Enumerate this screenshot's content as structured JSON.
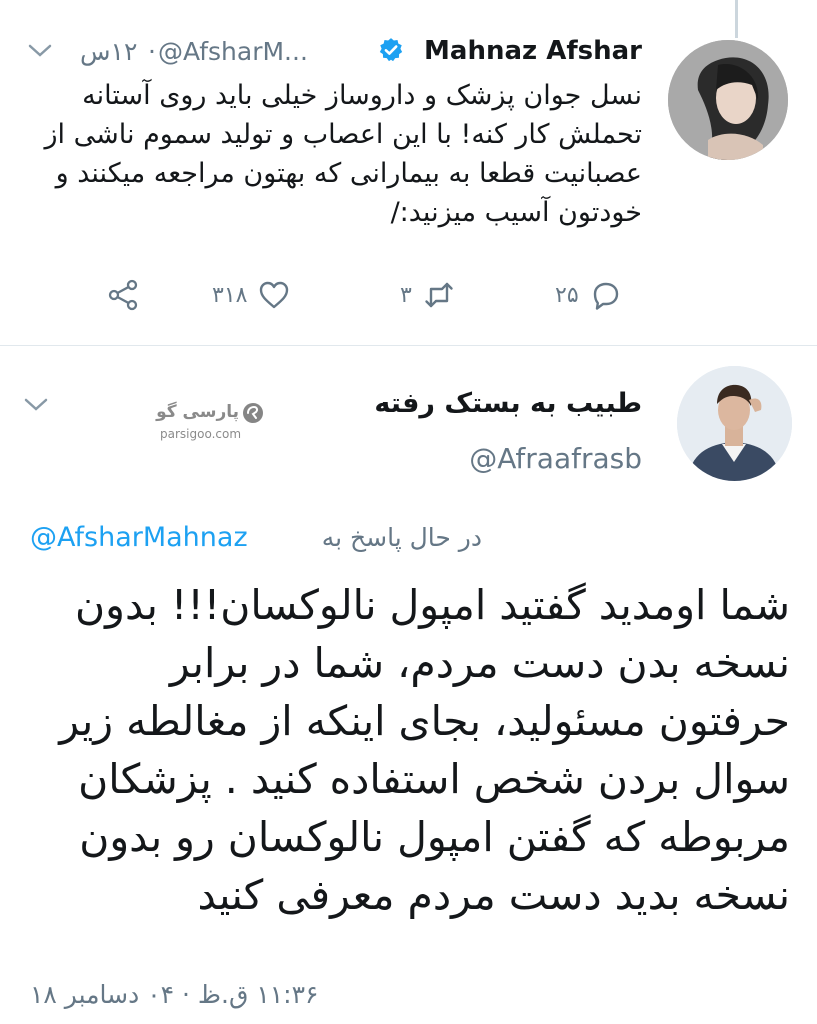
{
  "reply_tweet": {
    "author_name": "Mahnaz Afshar",
    "handle": "@AfsharM...",
    "separator": "·",
    "time": "۱۲س",
    "text": "نسل جوان پزشک و داروساز خیلی باید روی آستانه تحملش کار کنه! با این اعصاب و تولید سموم ناشی از عصبانیت قطعا به بیمارانی که بهتون مراجعه میکنند و خودتون آسیب میزنید:/",
    "actions": {
      "reply_count": "۲۵",
      "retweet_count": "۳",
      "like_count": "۳۱۸"
    }
  },
  "main_tweet": {
    "author_name": "طبیب به بستک رفته",
    "handle": "@Afraafrasb",
    "replying_label": "در حال پاسخ به",
    "replying_handle": "@AfsharMahnaz",
    "text": "شما اومدید گفتید امپول نالوکسان!!! بدون نسخه بدن دست مردم، شما در برابر حرفتون مسئولید، بجای اینکه از مغالطه زیر سوال بردن شخص استفاده کنید . پزشکان مربوطه که گفتن امپول نالوکسان رو بدون نسخه بدید دست مردم معرفی کنید",
    "timestamp": "۱۱:۳۶ ق.ظ · ۰۴ دسامبر ۱۸"
  },
  "watermark": {
    "name_fa": "پارسی گو",
    "url": "parsigoo.com"
  },
  "colors": {
    "link_blue": "#1da1f2",
    "meta_gray": "#657786",
    "text_dark": "#14171a",
    "divider": "#e1e8ed"
  }
}
